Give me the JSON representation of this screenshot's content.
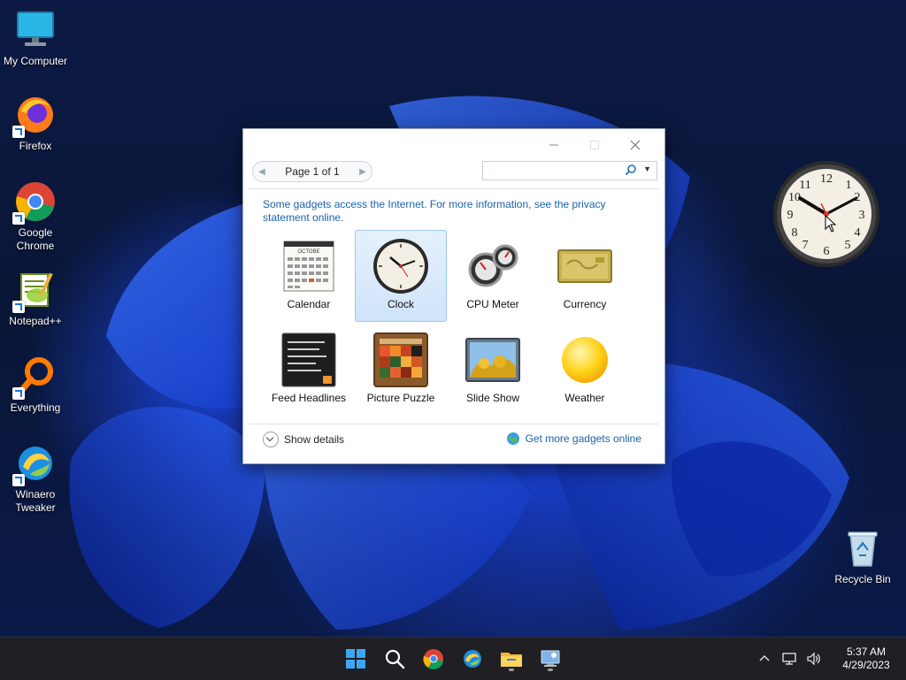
{
  "desktop": {
    "icons": [
      {
        "label_line1": "My Computer",
        "label_line2": ""
      },
      {
        "label_line1": "Firefox",
        "label_line2": ""
      },
      {
        "label_line1": "Google",
        "label_line2": "Chrome"
      },
      {
        "label_line1": "Notepad++",
        "label_line2": ""
      },
      {
        "label_line1": "Everything",
        "label_line2": ""
      },
      {
        "label_line1": "Winaero",
        "label_line2": "Tweaker"
      },
      {
        "label_line1": "Recycle Bin",
        "label_line2": ""
      }
    ]
  },
  "gadget_window": {
    "title_controls": [
      "minimize-icon",
      "maximize-icon",
      "close-icon"
    ],
    "pager_text": "Page 1 of 1",
    "search": {
      "value": "",
      "placeholder": ""
    },
    "notice": "Some gadgets access the Internet.  For more information, see the privacy statement online.",
    "gadgets": [
      {
        "name": "Calendar",
        "icon": "calendar-icon"
      },
      {
        "name": "Clock",
        "icon": "clock-icon",
        "selected": true
      },
      {
        "name": "CPU Meter",
        "icon": "cpu-meter-icon"
      },
      {
        "name": "Currency",
        "icon": "currency-icon"
      },
      {
        "name": "Feed Headlines",
        "icon": "feed-headlines-icon"
      },
      {
        "name": "Picture Puzzle",
        "icon": "picture-puzzle-icon"
      },
      {
        "name": "Slide Show",
        "icon": "slide-show-icon"
      },
      {
        "name": "Weather",
        "icon": "weather-icon"
      }
    ],
    "calendar_month": "OCTOBE",
    "show_details": "Show details",
    "get_more": "Get more gadgets online"
  },
  "taskbar": {
    "apps": [
      "start-icon",
      "search-icon",
      "chrome-icon",
      "winaero-icon",
      "file-explorer-icon",
      "gadgets-icon"
    ],
    "tray_icons": [
      "chevron-up-icon",
      "network-icon",
      "volume-icon"
    ],
    "time": "5:37 AM",
    "date": "4/29/2023"
  },
  "colors": {
    "accent_link": "#1a62a8",
    "selection_bg": "#cfe4fa",
    "taskbar_bg": "#1f1f24"
  }
}
